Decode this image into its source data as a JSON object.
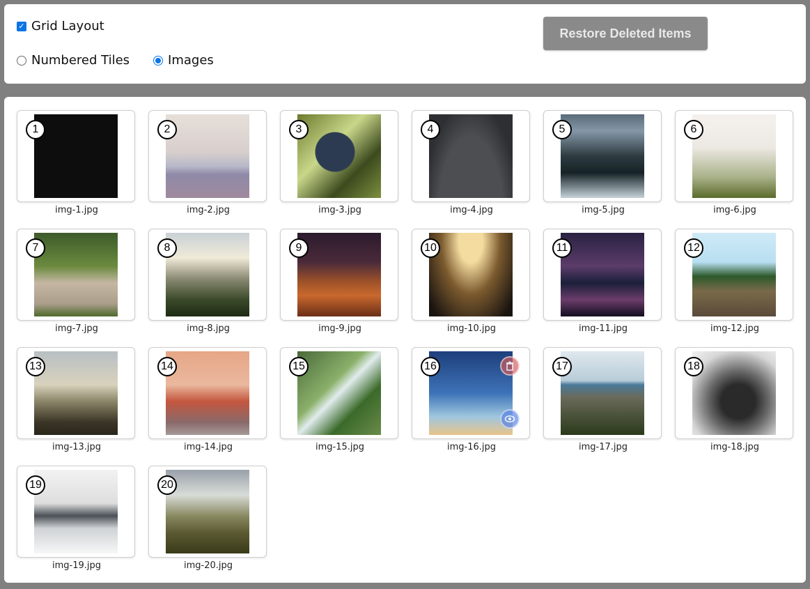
{
  "controls": {
    "grid_layout_label": "Grid Layout",
    "numbered_tiles_label": "Numbered Tiles",
    "images_label": "Images",
    "restore_label": "Restore Deleted Items",
    "grid_layout_checked": true,
    "selected_mode": "Images"
  },
  "gallery": {
    "tiles": [
      {
        "number": "1",
        "caption": "img-1.jpg"
      },
      {
        "number": "2",
        "caption": "img-2.jpg"
      },
      {
        "number": "3",
        "caption": "img-3.jpg"
      },
      {
        "number": "4",
        "caption": "img-4.jpg"
      },
      {
        "number": "5",
        "caption": "img-5.jpg"
      },
      {
        "number": "6",
        "caption": "img-6.jpg"
      },
      {
        "number": "7",
        "caption": "img-7.jpg"
      },
      {
        "number": "8",
        "caption": "img-8.jpg"
      },
      {
        "number": "9",
        "caption": "img-9.jpg"
      },
      {
        "number": "10",
        "caption": "img-10.jpg"
      },
      {
        "number": "11",
        "caption": "img-11.jpg"
      },
      {
        "number": "12",
        "caption": "img-12.jpg"
      },
      {
        "number": "13",
        "caption": "img-13.jpg"
      },
      {
        "number": "14",
        "caption": "img-14.jpg"
      },
      {
        "number": "15",
        "caption": "img-15.jpg"
      },
      {
        "number": "16",
        "caption": "img-16.jpg"
      },
      {
        "number": "17",
        "caption": "img-17.jpg"
      },
      {
        "number": "18",
        "caption": "img-18.jpg"
      },
      {
        "number": "19",
        "caption": "img-19.jpg"
      },
      {
        "number": "20",
        "caption": "img-20.jpg"
      }
    ],
    "hovered_tile": "16",
    "hover_icons": [
      "trash-icon",
      "eye-icon"
    ]
  },
  "colors": {
    "page_bg": "#808080",
    "accent": "#0b75e6",
    "button_bg": "#8a8a8a"
  }
}
